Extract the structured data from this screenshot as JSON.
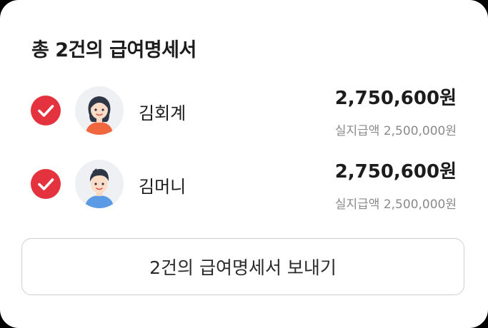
{
  "header": {
    "title": "총 2건의 급여명세서"
  },
  "colors": {
    "check_accent": "#e4323f",
    "text_primary": "#1c1c1c",
    "text_secondary": "#8a8a8a",
    "button_border": "#cfcfcf"
  },
  "recipients": [
    {
      "name": "김회계",
      "amount": "2,750,600원",
      "net_pay": "실지급액 2,500,000원",
      "checked": true,
      "avatar_icon": "female-avatar-icon"
    },
    {
      "name": "김머니",
      "amount": "2,750,600원",
      "net_pay": "실지급액 2,500,000원",
      "checked": true,
      "avatar_icon": "male-avatar-icon"
    }
  ],
  "actions": {
    "send_label": "2건의 급여명세서 보내기"
  }
}
